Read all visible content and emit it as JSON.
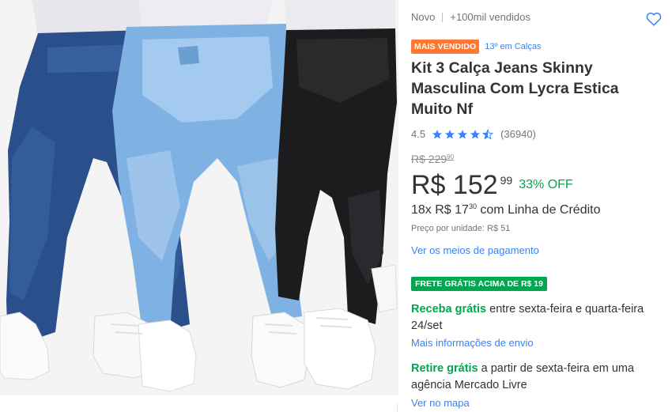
{
  "product": {
    "condition": "Novo",
    "sold": "+100mil vendidos",
    "badge_top": "MAIS VENDIDO",
    "rank": "13º em Calças",
    "title": "Kit 3 Calça Jeans Skinny Masculina Com Lycra Estica Muito Nf",
    "rating": {
      "score": "4.5",
      "stars": 4.5,
      "count": "(36940)"
    },
    "price": {
      "old_int": "R$ 229",
      "old_cents": "90",
      "current_int": "R$ 152",
      "current_cents": "99",
      "discount": "33% OFF",
      "installments_prefix": "18x R$ 17",
      "installments_cents": "30",
      "installments_suffix": " com Linha de Crédito",
      "unit_price": "Preço por unidade: R$ 51"
    },
    "payment_link": "Ver os meios de pagamento"
  },
  "shipping": {
    "free_badge": "FRETE GRÁTIS ACIMA DE R$ 19",
    "delivery_green": "Receba grátis",
    "delivery_rest": " entre sexta-feira e quarta-feira 24/set",
    "delivery_link": "Mais informações de envio",
    "pickup_green": "Retire grátis",
    "pickup_rest": " a partir de sexta-feira em uma agência Mercado Livre",
    "pickup_link": "Ver no mapa"
  },
  "colors": {
    "accent_blue": "#3483fa",
    "green": "#00a650",
    "orange_badge": "#ff7733",
    "text": "#333333",
    "muted": "#737373"
  },
  "icons": {
    "favorite": "heart-outline-icon",
    "star": "star-icon"
  }
}
